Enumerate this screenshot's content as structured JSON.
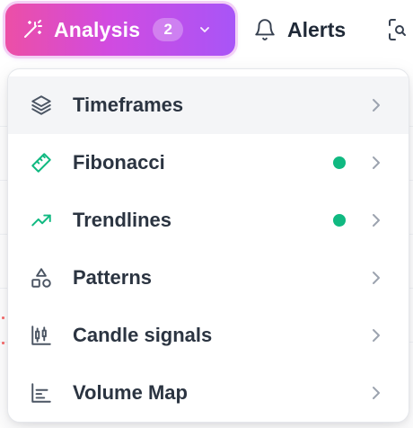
{
  "topbar": {
    "analysis": {
      "label": "Analysis",
      "count": "2",
      "icon": "magic-wand-icon"
    },
    "alerts": {
      "label": "Alerts",
      "icon": "bell-icon"
    },
    "scan": {
      "icon": "scan-search-icon"
    }
  },
  "menu": {
    "items": [
      {
        "label": "Timeframes",
        "icon": "layers-icon",
        "active": true,
        "enabled": false
      },
      {
        "label": "Fibonacci",
        "icon": "ruler-icon",
        "active": false,
        "enabled": true
      },
      {
        "label": "Trendlines",
        "icon": "trending-up-icon",
        "active": false,
        "enabled": true
      },
      {
        "label": "Patterns",
        "icon": "shapes-icon",
        "active": false,
        "enabled": false
      },
      {
        "label": "Candle signals",
        "icon": "candlestick-icon",
        "active": false,
        "enabled": false
      },
      {
        "label": "Volume Map",
        "icon": "bar-chart-icon",
        "active": false,
        "enabled": false
      }
    ]
  },
  "colors": {
    "brand_gradient_start": "#ec4fa6",
    "brand_gradient_end": "#a855f7",
    "enabled_dot": "#10b981",
    "icon_green": "#10b981",
    "icon_gray": "#4b5563"
  }
}
